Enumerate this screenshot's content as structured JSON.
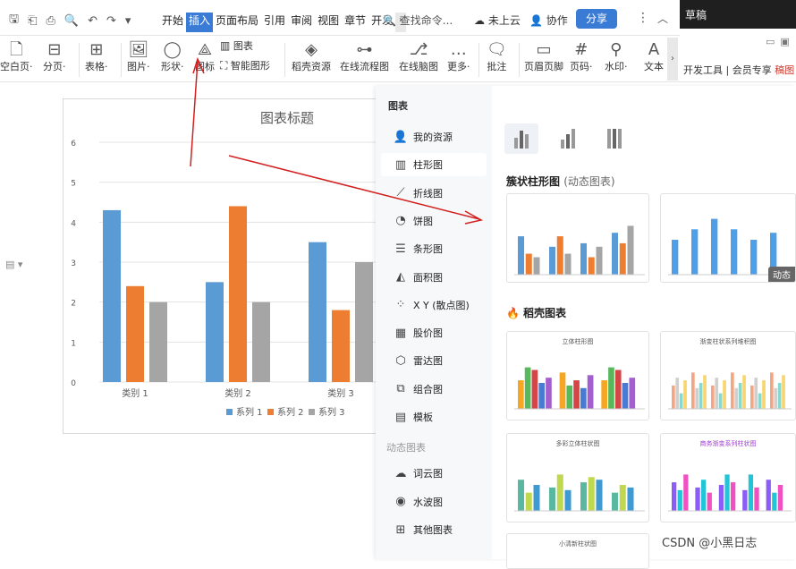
{
  "quick": {
    "dropdown_mark": "▾"
  },
  "menus": [
    "开始",
    "插入",
    "页面布局",
    "引用",
    "审阅",
    "视图",
    "章节",
    "开发"
  ],
  "menus_active_index": 1,
  "search_placeholder": "查找命令...",
  "cloud_label": "未上云",
  "collab_label": "协作",
  "share_label": "分享",
  "dark_tab": "草稿",
  "right_strip": {
    "text1": "开发工具",
    "text2": "会员专享",
    "text3": "稿图"
  },
  "toolbar": [
    {
      "name": "blank-page",
      "label": "空白页·",
      "icon": "🗋"
    },
    {
      "name": "page-break",
      "label": "分页·",
      "icon": "⊟"
    },
    {
      "name": "table",
      "label": "表格·",
      "icon": "⊞"
    },
    {
      "name": "picture",
      "label": "图片·",
      "icon": "🖼"
    },
    {
      "name": "shape",
      "label": "形状·",
      "icon": "◯"
    },
    {
      "name": "icon-lib",
      "label": "图标",
      "icon": "⟁"
    },
    {
      "name": "chart",
      "label": "图表",
      "icon": "▥"
    },
    {
      "name": "smart-graphic",
      "label": "智能图形",
      "icon": "⛶"
    },
    {
      "name": "resource",
      "label": "稻壳资源",
      "icon": "◈"
    },
    {
      "name": "flowchart",
      "label": "在线流程图",
      "icon": "⊶"
    },
    {
      "name": "mindmap",
      "label": "在线脑图",
      "icon": "⎇"
    },
    {
      "name": "more",
      "label": "更多·",
      "icon": "…"
    },
    {
      "name": "comment",
      "label": "批注",
      "icon": "🗨"
    },
    {
      "name": "header-footer",
      "label": "页眉页脚",
      "icon": "▭"
    },
    {
      "name": "page-number",
      "label": "页码·",
      "icon": "#"
    },
    {
      "name": "watermark",
      "label": "水印·",
      "icon": "⚲"
    },
    {
      "name": "textbox",
      "label": "文本",
      "icon": "A"
    }
  ],
  "chart_data": {
    "type": "bar",
    "title": "图表标题",
    "categories": [
      "类别 1",
      "类别 2",
      "类别 3"
    ],
    "series": [
      {
        "name": "系列 1",
        "color": "#5b9bd5",
        "values": [
          4.3,
          2.5,
          3.5
        ]
      },
      {
        "name": "系列 2",
        "color": "#ed7d31",
        "values": [
          2.4,
          4.4,
          1.8
        ]
      },
      {
        "name": "系列 3",
        "color": "#a5a5a5",
        "values": [
          2.0,
          2.0,
          3.0
        ]
      }
    ],
    "ylim": [
      0,
      6
    ],
    "yticks": [
      0,
      1,
      2,
      3,
      4,
      5,
      6
    ],
    "grid": true,
    "legend": "bottom"
  },
  "panel": {
    "title": "图表",
    "items": [
      {
        "label": "我的资源",
        "icon": "👤"
      },
      {
        "label": "柱形图",
        "icon": "▥"
      },
      {
        "label": "折线图",
        "icon": "⟋"
      },
      {
        "label": "饼图",
        "icon": "◔"
      },
      {
        "label": "条形图",
        "icon": "☰"
      },
      {
        "label": "面积图",
        "icon": "◭"
      },
      {
        "label": "X Y (散点图)",
        "icon": "⁘"
      },
      {
        "label": "股价图",
        "icon": "▦"
      },
      {
        "label": "雷达图",
        "icon": "⬡"
      },
      {
        "label": "组合图",
        "icon": "⧉"
      },
      {
        "label": "模板",
        "icon": "▤"
      }
    ],
    "dynamic_section": "动态图表",
    "dynamic_items": [
      {
        "label": "词云图",
        "icon": "☁"
      },
      {
        "label": "水波图",
        "icon": "◉"
      },
      {
        "label": "其他图表",
        "icon": "⊞"
      }
    ],
    "section_title": "簇状柱形图",
    "section_sub": "(动态图表)",
    "badge": "动态",
    "featured": "稻壳图表",
    "thumb_titles": [
      "立体柱形图",
      "渐变柱状系列堆积图",
      "多彩立体柱状图",
      "商务渐变系列柱状图",
      "小清新柱状图"
    ]
  },
  "watermark": "CSDN @小黑日志"
}
